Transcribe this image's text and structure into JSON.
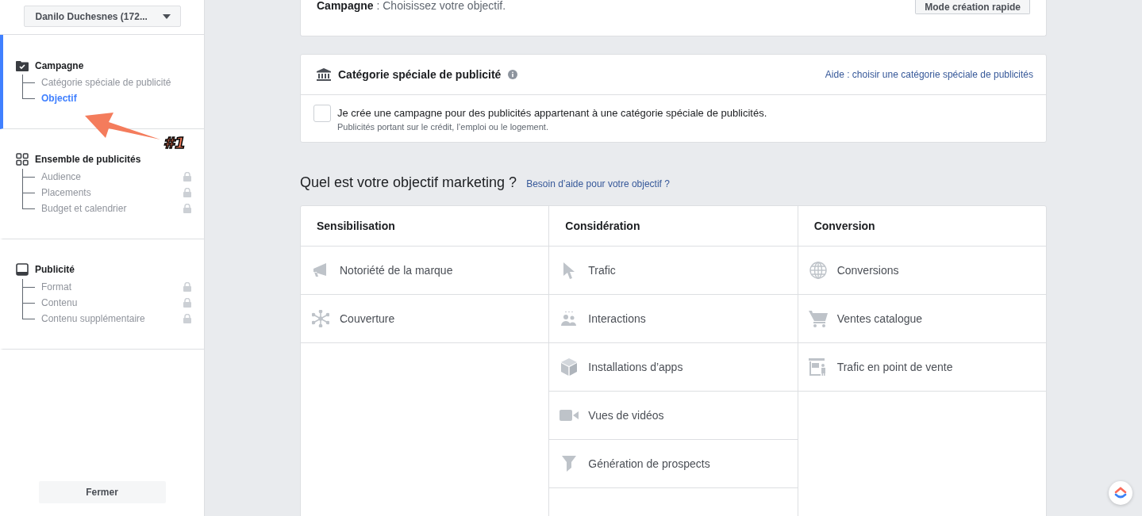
{
  "account_selector": {
    "label": "Danilo Duchesnes (172..."
  },
  "sidebar": {
    "sections": [
      {
        "title": "Campagne",
        "kind": "folder-check",
        "active": true,
        "items": [
          {
            "label": "Catégorie spéciale de publicité",
            "selected": false,
            "locked": false
          },
          {
            "label": "Objectif",
            "selected": true,
            "locked": false
          }
        ]
      },
      {
        "title": "Ensemble de publicités",
        "kind": "grid",
        "active": false,
        "items": [
          {
            "label": "Audience",
            "selected": false,
            "locked": true
          },
          {
            "label": "Placements",
            "selected": false,
            "locked": true
          },
          {
            "label": "Budget et calendrier",
            "selected": false,
            "locked": true
          }
        ]
      },
      {
        "title": "Publicité",
        "kind": "tablet",
        "active": false,
        "items": [
          {
            "label": "Format",
            "selected": false,
            "locked": true
          },
          {
            "label": "Contenu",
            "selected": false,
            "locked": true
          },
          {
            "label": "Contenu supplémentaire",
            "selected": false,
            "locked": true
          }
        ]
      }
    ],
    "close_button": "Fermer"
  },
  "annotation": {
    "label": "#1"
  },
  "header_card": {
    "title": "Campagne",
    "subtitle": " : Choisissez votre objectif.",
    "button": "Mode création rapide"
  },
  "special_category": {
    "title": "Catégorie spéciale de publicité",
    "help_link": "Aide : choisir une catégorie spéciale de publicités",
    "checkbox": {
      "checked": false,
      "label": "Je crée une campagne pour des publicités appartenant à une catégorie spéciale de publicités.",
      "description": "Publicités portant sur le crédit, l’emploi ou le logement."
    }
  },
  "objective": {
    "question": "Quel est votre objectif marketing ?",
    "help_link": "Besoin d’aide pour votre objectif ?",
    "columns": [
      {
        "heading": "Sensibilisation",
        "items": [
          {
            "label": "Notoriété de la marque",
            "kind": "megaphone"
          },
          {
            "label": "Couverture",
            "kind": "network"
          }
        ]
      },
      {
        "heading": "Considération",
        "items": [
          {
            "label": "Trafic",
            "kind": "cursor"
          },
          {
            "label": "Interactions",
            "kind": "people"
          },
          {
            "label": "Installations d’apps",
            "kind": "cube"
          },
          {
            "label": "Vues de vidéos",
            "kind": "video"
          },
          {
            "label": "Génération de prospects",
            "kind": "funnel"
          }
        ]
      },
      {
        "heading": "Conversion",
        "items": [
          {
            "label": "Conversions",
            "kind": "globe"
          },
          {
            "label": "Ventes catalogue",
            "kind": "cart"
          },
          {
            "label": "Trafic en point de vente",
            "kind": "store"
          }
        ]
      }
    ]
  }
}
